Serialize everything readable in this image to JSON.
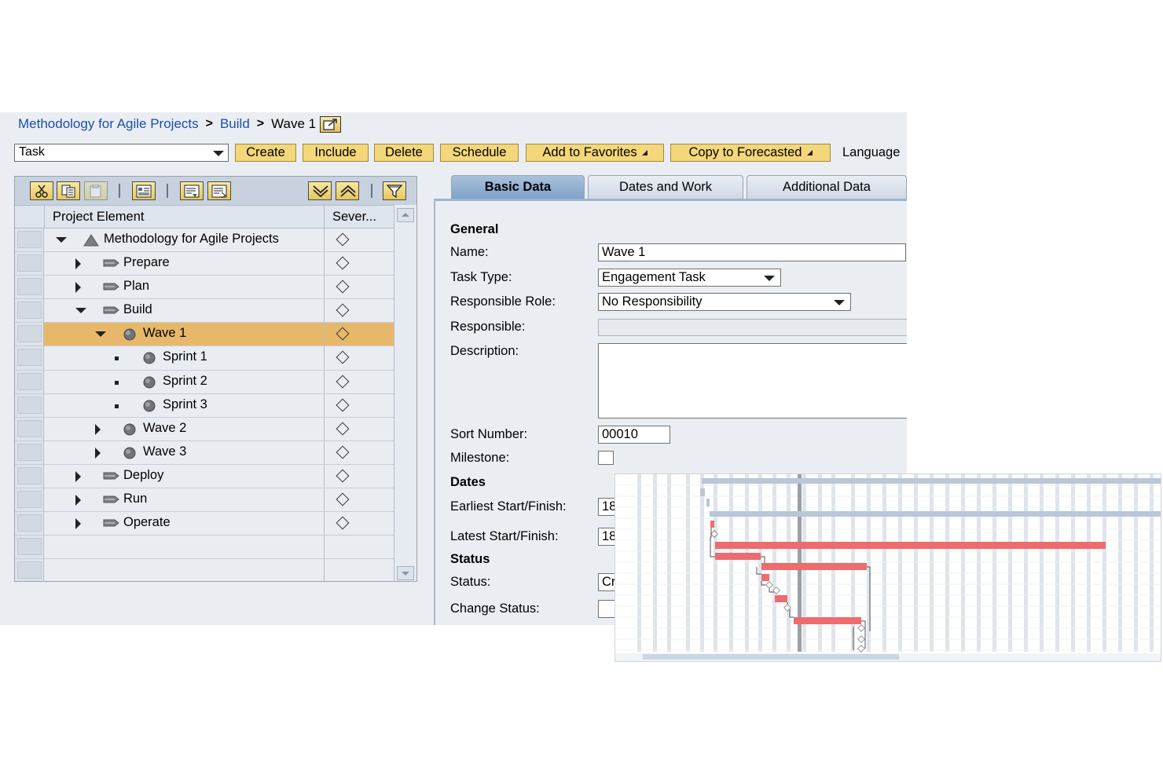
{
  "breadcrumb": {
    "items": [
      "Methodology for Agile Projects",
      "Build"
    ],
    "current": "Wave 1",
    "separator": ">"
  },
  "toolbar": {
    "type_select": "Task",
    "buttons": [
      {
        "label": "Create",
        "dropdown": false
      },
      {
        "label": "Include",
        "dropdown": false
      },
      {
        "label": "Delete",
        "dropdown": false
      },
      {
        "label": "Schedule",
        "dropdown": false
      },
      {
        "label": "Add to Favorites",
        "dropdown": true
      },
      {
        "label": "Copy to Forecasted",
        "dropdown": true
      }
    ],
    "language_label": "Language"
  },
  "tree": {
    "columns": [
      "Project Element",
      "Sever..."
    ],
    "rows": [
      {
        "label": "Methodology for Agile Projects",
        "level": 0,
        "toggle": "down",
        "icon": "triangle-icon",
        "selected": false
      },
      {
        "label": "Prepare",
        "level": 1,
        "toggle": "right",
        "icon": "phase-icon",
        "selected": false
      },
      {
        "label": "Plan",
        "level": 1,
        "toggle": "right",
        "icon": "phase-icon",
        "selected": false
      },
      {
        "label": "Build",
        "level": 1,
        "toggle": "down",
        "icon": "phase-icon",
        "selected": false
      },
      {
        "label": "Wave 1",
        "level": 2,
        "toggle": "down",
        "icon": "task-icon",
        "selected": true
      },
      {
        "label": "Sprint 1",
        "level": 3,
        "toggle": "leaf",
        "icon": "task-icon",
        "selected": false
      },
      {
        "label": "Sprint 2",
        "level": 3,
        "toggle": "leaf",
        "icon": "task-icon",
        "selected": false
      },
      {
        "label": "Sprint 3",
        "level": 3,
        "toggle": "leaf",
        "icon": "task-icon",
        "selected": false
      },
      {
        "label": "Wave 2",
        "level": 2,
        "toggle": "right",
        "icon": "task-icon",
        "selected": false
      },
      {
        "label": "Wave 3",
        "level": 2,
        "toggle": "right",
        "icon": "task-icon",
        "selected": false
      },
      {
        "label": "Deploy",
        "level": 1,
        "toggle": "right",
        "icon": "phase-icon",
        "selected": false
      },
      {
        "label": "Run",
        "level": 1,
        "toggle": "right",
        "icon": "phase-icon",
        "selected": false
      },
      {
        "label": "Operate",
        "level": 1,
        "toggle": "right",
        "icon": "phase-icon",
        "selected": false
      }
    ],
    "empty_rows": 2,
    "selected_row_color": "#e8b86a"
  },
  "tabs": [
    {
      "label": "Basic Data",
      "active": true
    },
    {
      "label": "Dates and Work",
      "active": false
    },
    {
      "label": "Additional Data",
      "active": false
    }
  ],
  "form": {
    "general_heading": "General",
    "name_label": "Name:",
    "name_value": "Wave 1",
    "task_type_label": "Task Type:",
    "task_type_value": "Engagement Task",
    "responsible_role_label": "Responsible Role:",
    "responsible_role_value": "No Responsibility",
    "responsible_label": "Responsible:",
    "responsible_value": "",
    "description_label": "Description:",
    "description_value": "",
    "sort_number_label": "Sort Number:",
    "sort_number_value": "00010",
    "milestone_label": "Milestone:",
    "milestone_checked": false,
    "dates_heading": "Dates",
    "earliest_label": "Earliest Start/Finish:",
    "earliest_value": "18",
    "latest_label": "Latest Start/Finish:",
    "latest_value": "18",
    "status_heading": "Status",
    "status_label": "Status:",
    "status_value": "Cr",
    "change_status_label": "Change Status:",
    "change_status_value": ""
  },
  "gantt": {
    "bar_color": "#ee6b6e",
    "summary_color": "#b9c7d8",
    "today_line_color": "#9aa0a6",
    "grid_color": "#dfe4ea"
  }
}
